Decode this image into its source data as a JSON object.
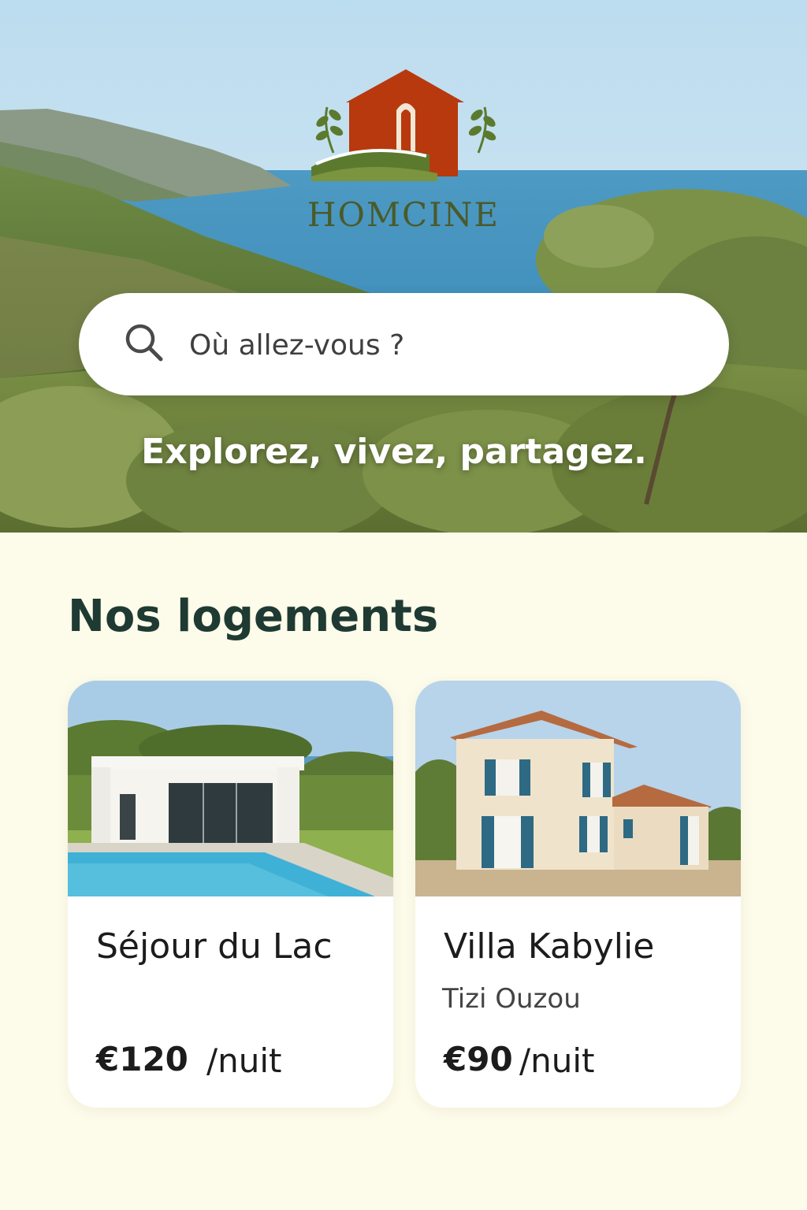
{
  "brand": {
    "name": "HOMCINE",
    "logo_icon": "house-logo-icon"
  },
  "search": {
    "placeholder": "Où allez-vous ?",
    "icon": "search-icon"
  },
  "hero": {
    "tagline": "Explorez, vivez, partagez."
  },
  "section": {
    "title": "Nos logements"
  },
  "listings": [
    {
      "title": "Séjour du Lac",
      "location": "",
      "price": "€120",
      "unit": "/nuit"
    },
    {
      "title": "Villa Kabylie",
      "location": "Tizi Ouzou",
      "price": "€90",
      "unit": "/nuit"
    }
  ],
  "colors": {
    "accent": "#b8390e",
    "brand_green": "#4b5a2a",
    "heading": "#1f3a33",
    "background": "#fdfbe9"
  }
}
